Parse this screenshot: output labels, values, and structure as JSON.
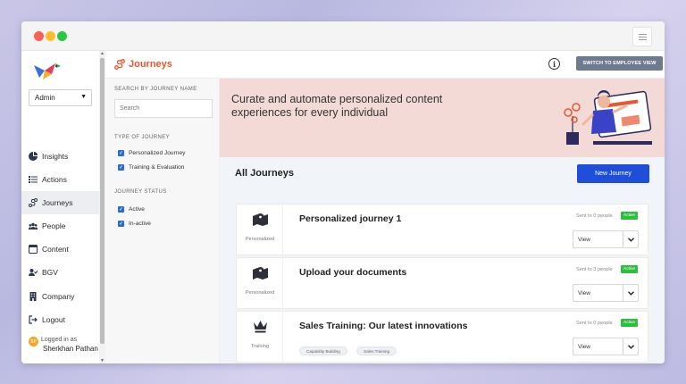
{
  "sidebar": {
    "role": "Admin",
    "items": [
      {
        "label": "Insights",
        "icon": "pie-chart-icon"
      },
      {
        "label": "Actions",
        "icon": "list-icon"
      },
      {
        "label": "Journeys",
        "icon": "route-icon"
      },
      {
        "label": "People",
        "icon": "people-icon"
      },
      {
        "label": "Content",
        "icon": "content-icon"
      },
      {
        "label": "BGV",
        "icon": "user-check-icon"
      },
      {
        "label": "Company",
        "icon": "building-icon"
      },
      {
        "label": "Logout",
        "icon": "logout-icon"
      }
    ],
    "active_item": "Journeys",
    "user": {
      "logged_in_label": "Logged in as",
      "name": "Sherkhan Pathan",
      "initials": "SP"
    }
  },
  "header": {
    "title": "Journeys",
    "switch_button": "SWITCH TO EMPLOYEE VIEW",
    "accent": "#e8572f"
  },
  "filters": {
    "search_heading": "SEARCH BY JOURNEY NAME",
    "search_placeholder": "Search",
    "type_heading": "TYPE OF JOURNEY",
    "types": [
      "Personalized Journey",
      "Training & Evaluation"
    ],
    "status_heading": "JOURNEY STATUS",
    "statuses": [
      "Active",
      "In-active"
    ]
  },
  "banner": {
    "text": "Curate and automate personalized content experiences for every individual"
  },
  "journeys": {
    "heading": "All Journeys",
    "new_button": "New Journey",
    "items": [
      {
        "title": "Personalized journey 1",
        "type": "Personalized",
        "sent": "Sent to 0 people",
        "status": "Active",
        "action": "View",
        "tags": []
      },
      {
        "title": "Upload your documents",
        "type": "Personalized",
        "sent": "Sent to 3 people",
        "status": "Active",
        "action": "View",
        "tags": []
      },
      {
        "title": "Sales Training: Our latest innovations",
        "type": "Training",
        "sent": "Sent to 0 people",
        "status": "Active",
        "action": "View",
        "tags": [
          "Capability Building",
          "Sales Training"
        ]
      }
    ]
  },
  "colors": {
    "primary_button": "#1f4fd8",
    "active_badge": "#2fbf3f",
    "banner_bg": "#f3dad7"
  }
}
